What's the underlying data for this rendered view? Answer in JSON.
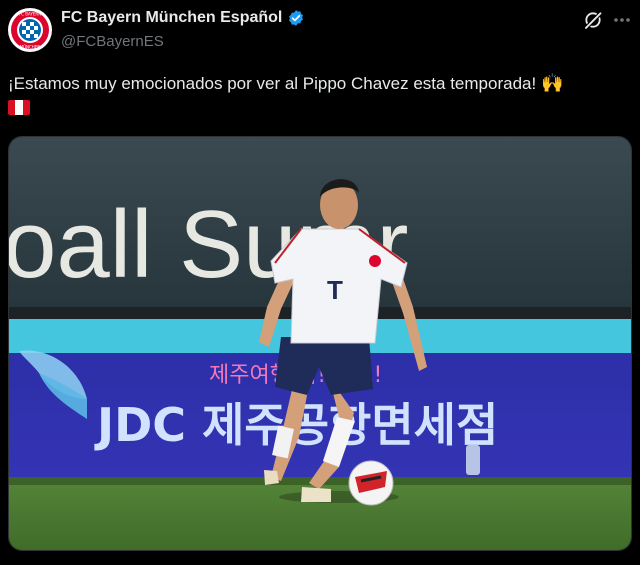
{
  "account": {
    "display_name": "FC Bayern München Español",
    "handle": "@FCBayernES",
    "avatar_text_top": "FC BAYERN",
    "avatar_text_bottom": "MÜNCHEN"
  },
  "tweet": {
    "text": "¡Estamos muy emocionados por ver al Pippo Chavez esta temporada!",
    "emoji": "🙌"
  },
  "media": {
    "banner_text": "oall Sumr",
    "board_korean_top": "제주여행 딱! 구즈!",
    "board_brand": "JDC 제주공항면세점",
    "shirt_sponsor": "T"
  },
  "colors": {
    "background": "#000000",
    "text": "#e7e9ea",
    "muted": "#71767b",
    "verified": "#1d9bf0",
    "bayern_red": "#dc052d",
    "pitch": "#4b7a2f"
  }
}
